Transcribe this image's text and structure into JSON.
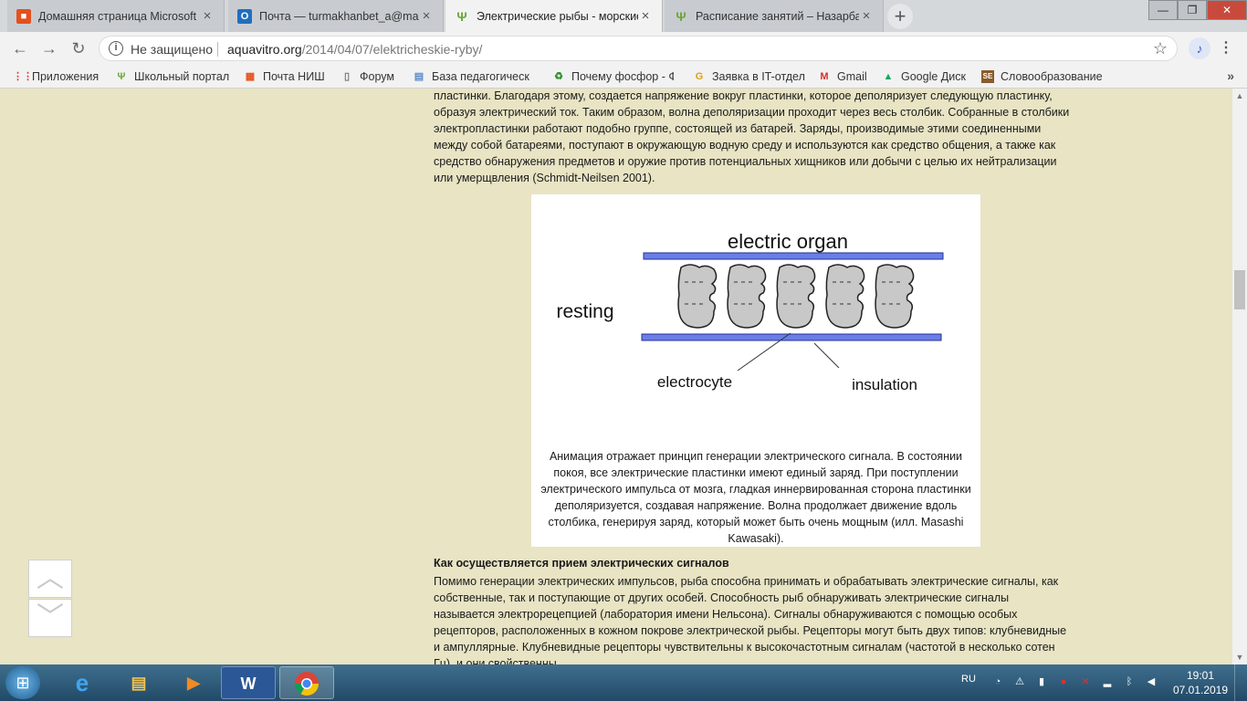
{
  "tabs": [
    {
      "title": "Домашняя страница Microsoft C",
      "icon": "office-icon",
      "color": "#e3511e",
      "close": "×"
    },
    {
      "title": "Почта — turmakhanbet_a@mail.",
      "icon": "outlook-icon",
      "color": "#1f6fbe",
      "close": "×"
    },
    {
      "title": "Электрические рыбы - морские",
      "icon": "aquavitro-icon",
      "color": "#6aa83a",
      "close": "×"
    },
    {
      "title": "Расписание занятий – Назарбае",
      "icon": "nis-icon",
      "color": "#6aa83a",
      "close": "×"
    }
  ],
  "new_tab_label": "+",
  "window_controls": [
    "—",
    "❐",
    "✕"
  ],
  "toolbar": {
    "security_label": "Не защищено",
    "url_host": "aquavitro.org",
    "url_path": "/2014/04/07/elektricheskie-ryby/"
  },
  "bookmarks": [
    {
      "label": "Приложения",
      "icon": "apps-grid-icon",
      "color": "#e33"
    },
    {
      "label": "Школьный портал",
      "icon": "sprout-icon",
      "color": "#6aa83a"
    },
    {
      "label": "Почта НИШ",
      "icon": "windows-logo-icon",
      "color": "#e3511e"
    },
    {
      "label": "Форум",
      "icon": "page-icon",
      "color": "#777"
    },
    {
      "label": "База педагогическ",
      "icon": "document-icon",
      "color": "#5b8ac6"
    },
    {
      "label": "Почему фосфор - Ф",
      "icon": "recycle-icon",
      "color": "#2f8f2f"
    },
    {
      "label": "Заявка в IT-отдел",
      "icon": "google-g-icon",
      "color": "#d8a020"
    },
    {
      "label": "Gmail",
      "icon": "gmail-icon",
      "color": "#d93025"
    },
    {
      "label": "Google Диск",
      "icon": "google-drive-icon",
      "color": "#1fa463"
    },
    {
      "label": "Словообразование",
      "icon": "se-logo-icon",
      "color": "#8b5a2b"
    }
  ],
  "bookmarks_more": "»",
  "article": {
    "para_top": "пластинки. Благодаря этому, создается напряжение вокруг пластинки, которое деполяризует следующую пластинку, образуя электрический ток. Таким образом, волна деполяризации проходит через весь столбик. Собранные в столбики электропластинки работают подобно группе, состоящей из батарей. Заряды, производимые этими соединенными между собой батареями, поступают в окружающую водную среду и используются как средство общения, а также как средство обнаружения предметов и оружие против потенциальных хищников или добычи с целью их нейтрализации или умерщвления (Schmidt-Neilsen 2001).",
    "figure": {
      "title": "electric organ",
      "state": "resting",
      "label_electrocyte": "electrocyte",
      "label_insulation": "insulation",
      "caption": "Анимация отражает принцип генерации электрического сигнала. В состоянии покоя, все электрические пластинки имеют единый заряд. При поступлении электрического импульса от мозга, гладкая иннервированная сторона пластинки деполяризуется, создавая напряжение. Волна продолжает движение вдоль столбика, генерируя заряд, который может быть очень мощным (илл. Masashi Kawasaki)."
    },
    "heading": "Как осуществляется прием электрических сигналов",
    "para_bottom": "Помимо генерации электрических импульсов, рыба способна принимать и обрабатывать электрические сигналы, как собственные, так и поступающие от других особей. Способность рыб обнаруживать электрические сигналы называется электрорецепцией (лаборатория имени Нельсона). Сигналы обнаруживаются с помощью особых рецепторов, расположенных в кожном покрове электрической рыбы. Рецепторы могут быть двух типов: клубневидные и ампуллярные. Клубневидные рецепторы чувствительны к высокочастотным сигналам (частотой в несколько сотен Гц), и они свойственны"
  },
  "scroll_buttons": {
    "up": "︿",
    "down": "﹀"
  },
  "taskbar": {
    "apps": [
      "ie-icon",
      "explorer-icon",
      "media-player-icon",
      "word-icon",
      "chrome-icon"
    ],
    "language": "RU",
    "time": "19:01",
    "date": "07.01.2019"
  }
}
